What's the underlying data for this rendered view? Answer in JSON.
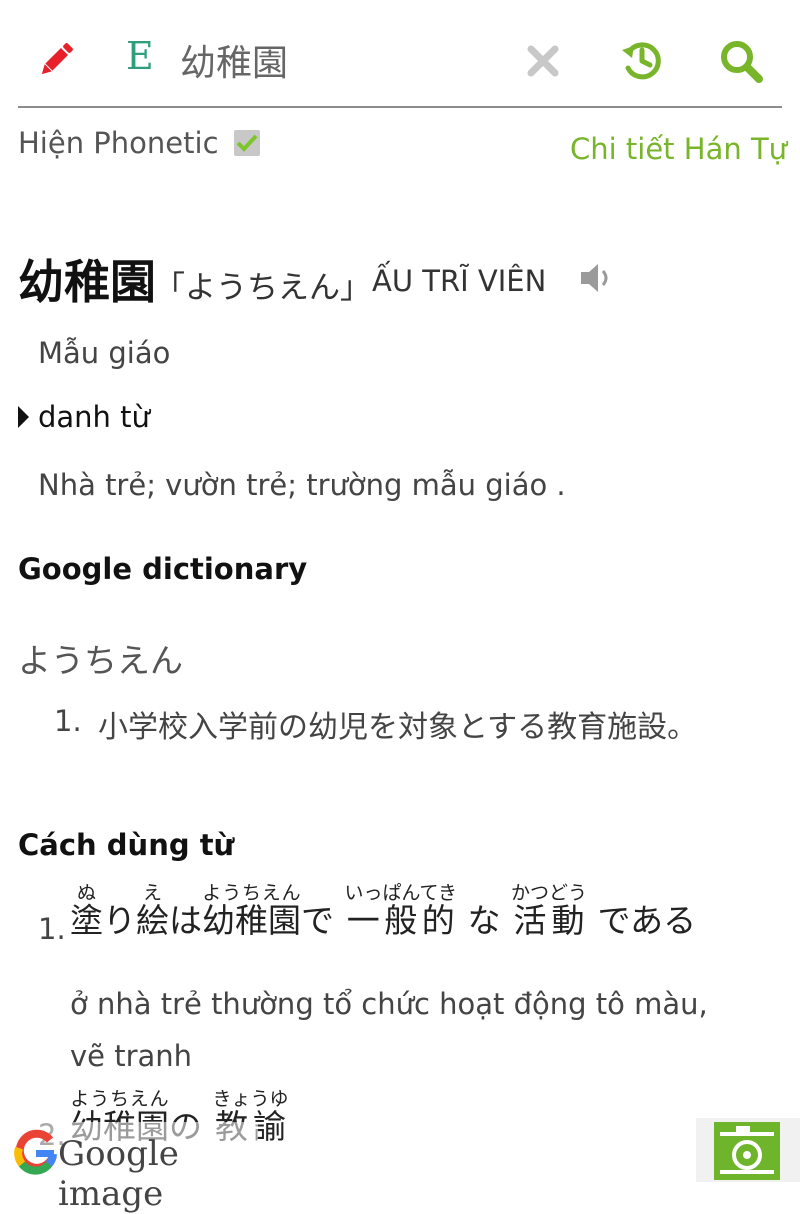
{
  "toolbar": {
    "mode_label": "E",
    "search_value": "幼稚園",
    "colors": {
      "edit": "#e8202a",
      "accent": "#78b52a",
      "clear": "#c8c8c8"
    },
    "icons": [
      "pencil-icon",
      "close-icon",
      "history-icon",
      "search-icon"
    ]
  },
  "options": {
    "phonetic_label": "Hiện Phonetic",
    "phonetic_checked": true,
    "hantu_link": "Chi tiết Hán Tự"
  },
  "entry": {
    "word": "幼稚園",
    "reading": "「ようちえん」",
    "hanviet": "ẤU TRĨ VIÊN",
    "meaning": "Mẫu giáo",
    "pos": "danh từ",
    "definition": "Nhà trẻ; vườn trẻ; trường mẫu giáo ."
  },
  "google_dictionary": {
    "title": "Google dictionary",
    "reading": "ようちえん",
    "definitions": [
      {
        "num": "1.",
        "text": "小学校入学前の幼児を対象とする教育施設。"
      }
    ]
  },
  "usage": {
    "title": "Cách dùng từ",
    "examples": [
      {
        "num": "1.",
        "parts": [
          {
            "base": "塗",
            "ruby": "ぬ"
          },
          {
            "text": "り"
          },
          {
            "base": "絵",
            "ruby": "え"
          },
          {
            "text": "は"
          },
          {
            "base": "幼稚園",
            "ruby": "ようちえん"
          },
          {
            "text": "で "
          },
          {
            "base": "一般的",
            "ruby": "いっぱんてき"
          },
          {
            "text": " な "
          },
          {
            "base": "活動",
            "ruby": "かつどう"
          },
          {
            "text": " である"
          }
        ],
        "translation": "ở nhà trẻ thường tổ chức hoạt động tô màu, vẽ tranh"
      },
      {
        "num": "2.",
        "parts": [
          {
            "base": "幼稚園",
            "ruby": "ようちえん"
          },
          {
            "text": "の "
          },
          {
            "base": "教諭",
            "ruby": "きょうゆ"
          }
        ]
      }
    ]
  },
  "bottom": {
    "google_image_label": "Google image",
    "camera_icon": "camera-icon",
    "camera_color": "#6fb52c"
  }
}
